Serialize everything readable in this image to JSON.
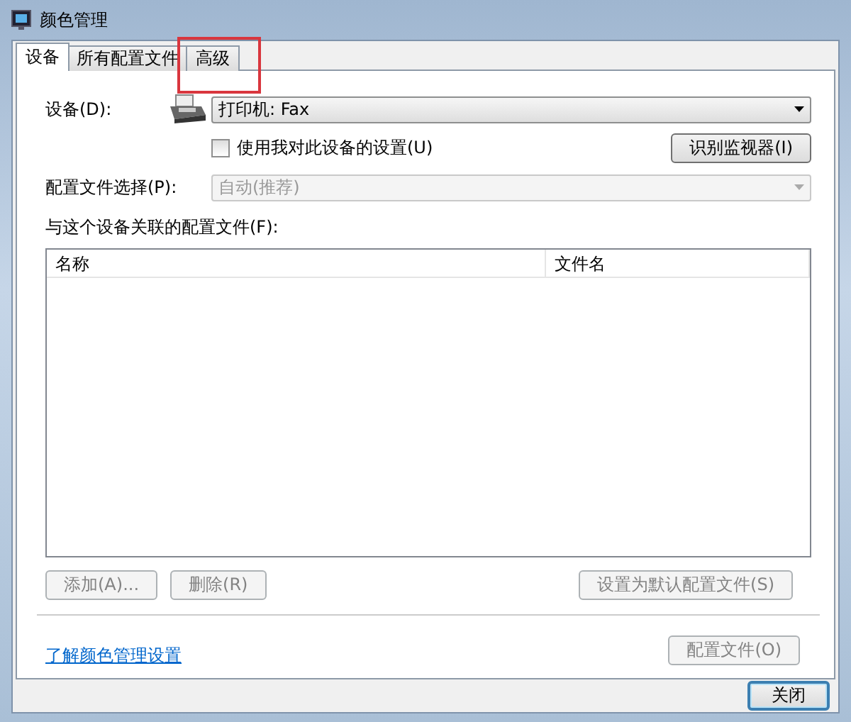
{
  "window": {
    "title": "颜色管理"
  },
  "tabs": [
    {
      "label": "设备",
      "selected": true,
      "highlighted": false
    },
    {
      "label": "所有配置文件",
      "selected": false,
      "highlighted": false
    },
    {
      "label": "高级",
      "selected": false,
      "highlighted": true
    }
  ],
  "device": {
    "label": "设备(D):",
    "value": "打印机: Fax"
  },
  "use_my_settings": {
    "label": "使用我对此设备的设置(U)",
    "checked": false
  },
  "identify_button": {
    "label": "识别监视器(I)",
    "disabled": false
  },
  "profile_selection": {
    "label": "配置文件选择(P):",
    "value": "自动(推荐)",
    "disabled": true
  },
  "profiles": {
    "label": "与这个设备关联的配置文件(F):",
    "columns": [
      "名称",
      "文件名"
    ]
  },
  "actions": [
    {
      "label": "添加(A)...",
      "disabled": true
    },
    {
      "label": "删除(R)",
      "disabled": true
    },
    {
      "label": "设置为默认配置文件(S)",
      "disabled": true
    }
  ],
  "help_link": "了解颜色管理设置",
  "profile_button": {
    "label": "配置文件(O)",
    "disabled": true
  },
  "close_button": {
    "label": "关闭",
    "focused": true
  }
}
